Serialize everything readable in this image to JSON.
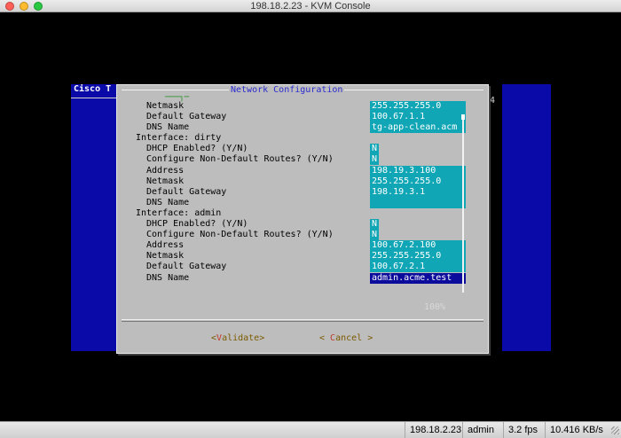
{
  "window": {
    "title": "198.18.2.23 - KVM Console"
  },
  "background": {
    "left_panel_title": "Cisco T",
    "right_fragment": "4"
  },
  "dialog": {
    "title": "Network Configuration",
    "title_fragment": "───┐─",
    "rows": [
      {
        "label": "Netmask",
        "value": "255.255.255.0",
        "kind": "field"
      },
      {
        "label": "Default Gateway",
        "value": "100.67.1.1",
        "kind": "field"
      },
      {
        "label": "DNS Name",
        "value": "tg-app-clean.acm",
        "kind": "field"
      },
      {
        "label": "Interface: dirty",
        "value": "",
        "kind": "iface"
      },
      {
        "label": "DHCP Enabled? (Y/N)",
        "value": "N",
        "kind": "field",
        "short": true
      },
      {
        "label": "Configure Non-Default Routes? (Y/N)",
        "value": "N",
        "kind": "field",
        "short": true
      },
      {
        "label": "Address",
        "value": "198.19.3.100",
        "kind": "field"
      },
      {
        "label": "Netmask",
        "value": "255.255.255.0",
        "kind": "field"
      },
      {
        "label": "Default Gateway",
        "value": "198.19.3.1",
        "kind": "field"
      },
      {
        "label": "DNS Name",
        "value": "",
        "kind": "field"
      },
      {
        "label": "Interface: admin",
        "value": "",
        "kind": "iface"
      },
      {
        "label": "DHCP Enabled? (Y/N)",
        "value": "N",
        "kind": "field",
        "short": true
      },
      {
        "label": "Configure Non-Default Routes? (Y/N)",
        "value": "N",
        "kind": "field",
        "short": true
      },
      {
        "label": "Address",
        "value": "100.67.2.100",
        "kind": "field"
      },
      {
        "label": "Netmask",
        "value": "255.255.255.0",
        "kind": "field"
      },
      {
        "label": "Default Gateway",
        "value": "100.67.2.1",
        "kind": "field"
      },
      {
        "label": "DNS Name",
        "value": "admin.acme.test",
        "kind": "field",
        "selected": true
      }
    ],
    "scroll_percent": "100%",
    "validate_button": {
      "open": "<",
      "hot": "V",
      "rest": "alidate",
      "close": ">"
    },
    "cancel_button": {
      "open": "< ",
      "hot": "C",
      "rest": "ancel",
      "close": " >"
    }
  },
  "statusbar": {
    "host": "198.18.2.23",
    "user": "admin",
    "fps": "3.2 fps",
    "speed": "10.416 KB/s"
  },
  "colors": {
    "console_bg": "#000000",
    "panel_blue": "#0a0aa8",
    "dialog_gray": "#bdbdbd",
    "field_cyan": "#10a6b6",
    "selected_field": "#0b0b9c",
    "title_blue": "#2b2bcf"
  }
}
